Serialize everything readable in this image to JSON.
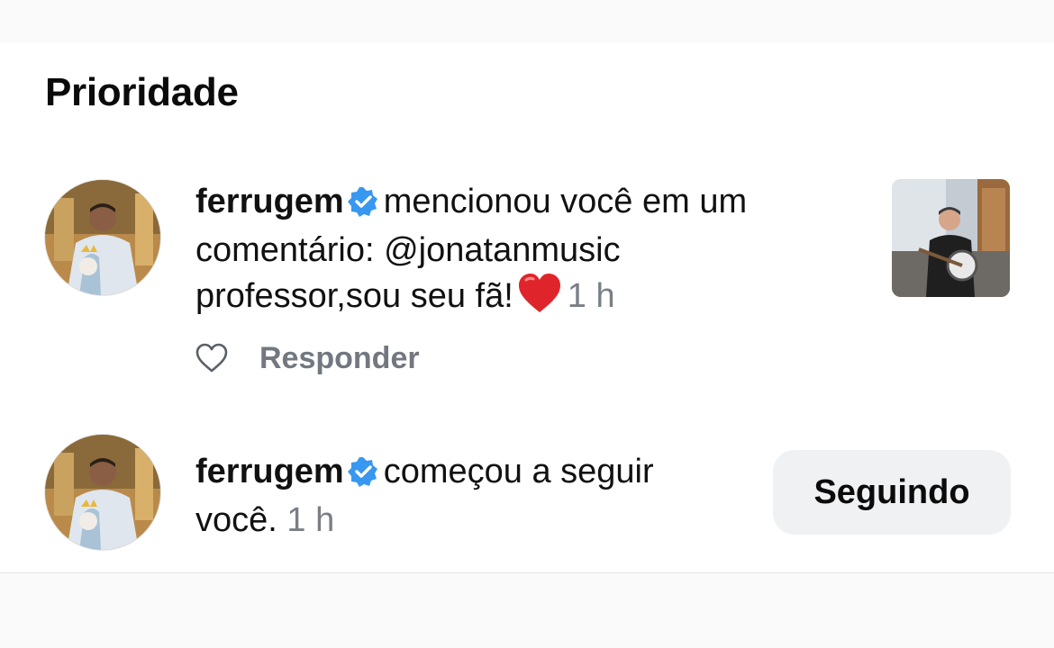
{
  "section": {
    "title": "Prioridade"
  },
  "notifications": [
    {
      "username": "ferrugem",
      "line1": "mencionou você em um",
      "line2": "comentário: @jonatanmusic",
      "line3": "professor,sou seu fã!",
      "emoji": "heart-emoji",
      "time": "1 h",
      "reply_label": "Responder",
      "thumbnail": "post-thumbnail-man-playing-banjo"
    },
    {
      "username": "ferrugem",
      "line1": "começou a seguir",
      "line2": "você.",
      "time": "1 h",
      "button_label": "Seguindo"
    }
  ],
  "colors": {
    "verified": "#3897f0",
    "muted_text": "#7a7f86",
    "button_bg": "#eff1f3",
    "heart": "#e0242b"
  }
}
